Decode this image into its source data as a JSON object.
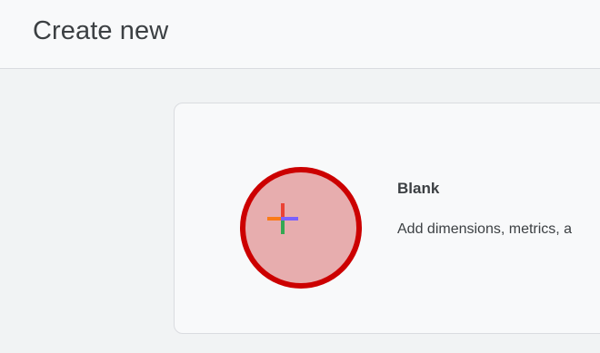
{
  "header": {
    "title": "Create new"
  },
  "blank_card": {
    "title": "Blank",
    "description": "Add dimensions, metrics, a",
    "icon": "colorful-plus-icon"
  },
  "colors": {
    "annotation_ring": "#cc0000",
    "annotation_fill": "#d66262",
    "plus_orange": "#fa7b17",
    "plus_red": "#ea4335",
    "plus_purple": "#7b61ff",
    "plus_green": "#34a853"
  }
}
